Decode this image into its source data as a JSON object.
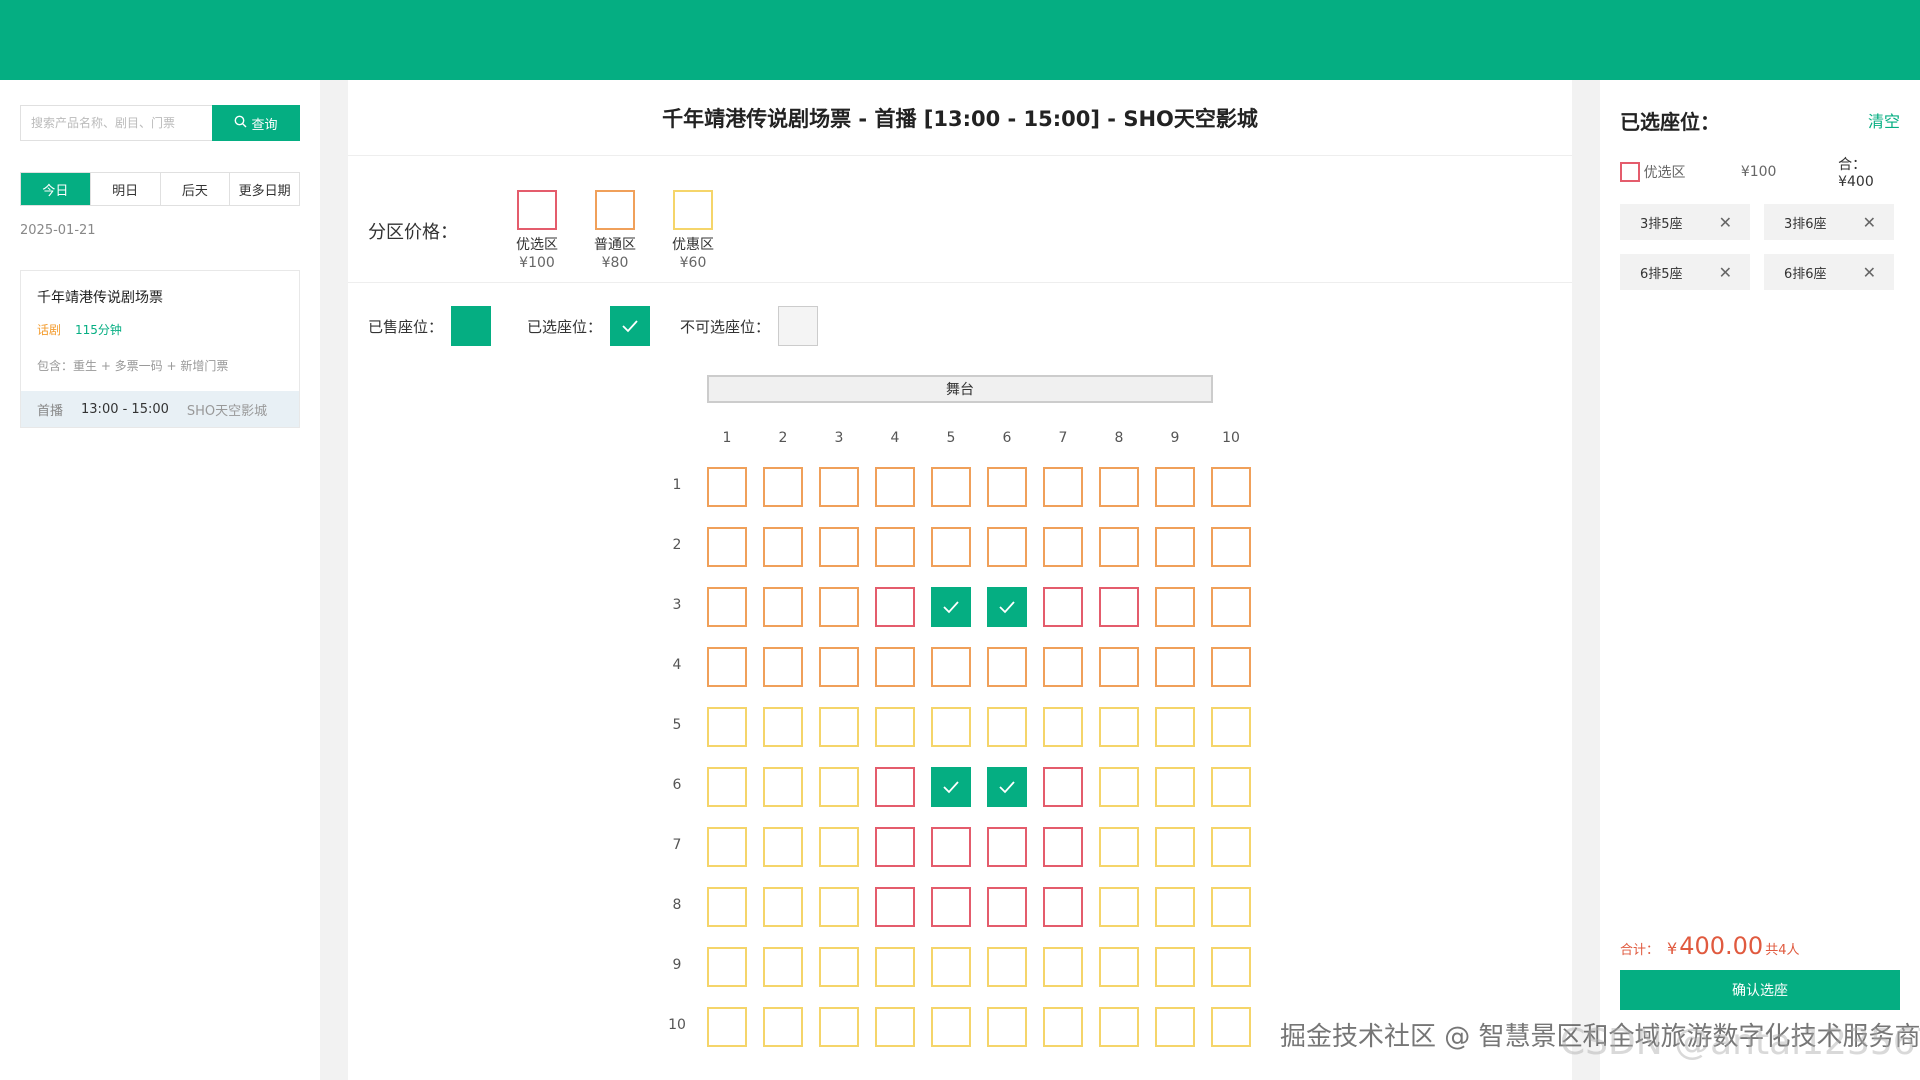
{
  "header": {
    "color": "#05ae82"
  },
  "search": {
    "placeholder": "搜索产品名称、剧目、门票",
    "button_label": "查询"
  },
  "date_tabs": [
    {
      "label": "今日",
      "active": true
    },
    {
      "label": "明日",
      "active": false
    },
    {
      "label": "后天",
      "active": false
    },
    {
      "label": "更多日期",
      "active": false
    }
  ],
  "current_date": "2025-01-21",
  "show": {
    "title": "千年靖港传说剧场票",
    "genre": "话剧",
    "duration": "115分钟",
    "includes": "包含：重生 + 多票一码 + 新增门票",
    "session": {
      "tag": "首播",
      "time": "13:00 - 15:00",
      "venue": "SHO天空影城"
    }
  },
  "main": {
    "title": "千年靖港传说剧场票 - 首播 [13:00 - 15:00] - SHO天空影城",
    "price_label": "分区价格：",
    "zones": [
      {
        "name": "优选区",
        "price": "¥100",
        "color": "#e45c6c"
      },
      {
        "name": "普通区",
        "price": "¥80",
        "color": "#f0a05a"
      },
      {
        "name": "优惠区",
        "price": "¥60",
        "color": "#f5d56a"
      }
    ],
    "legend": {
      "sold": "已售座位：",
      "selected": "已选座位：",
      "unavailable": "不可选座位："
    },
    "stage_label": "舞台",
    "columns": [
      "1",
      "2",
      "3",
      "4",
      "5",
      "6",
      "7",
      "8",
      "9",
      "10"
    ],
    "rows": [
      "1",
      "2",
      "3",
      "4",
      "5",
      "6",
      "7",
      "8",
      "9",
      "10"
    ]
  },
  "seat_map": {
    "zone_colors": {
      "premium": "#e45c6c",
      "standard": "#f0a05a",
      "discount": "#f5d56a"
    },
    "premium_seats": [
      "3-4",
      "3-7",
      "3-8",
      "6-4",
      "6-7",
      "7-4",
      "7-5",
      "7-6",
      "7-7",
      "8-4",
      "8-5",
      "8-6",
      "8-7"
    ],
    "standard_rows": [
      1,
      2,
      3,
      4
    ],
    "selected_seats": [
      "3-5",
      "3-6",
      "6-5",
      "6-6"
    ]
  },
  "selection": {
    "title": "已选座位：",
    "clear_label": "清空",
    "zone_name": "优选区",
    "zone_price": "¥100",
    "zone_total": "合：¥400",
    "tags": [
      {
        "label": "3排5座"
      },
      {
        "label": "3排6座"
      },
      {
        "label": "6排5座"
      },
      {
        "label": "6排6座"
      }
    ],
    "summary_label": "合计：",
    "summary_currency": "¥",
    "summary_amount": "400.00",
    "summary_count": "共4人",
    "confirm_label": "确认选座"
  },
  "watermark": {
    "text": "掘金技术社区 @ 智慧景区和全域旅游数字化技术服务商",
    "text2": "CSDN @antai123567"
  }
}
